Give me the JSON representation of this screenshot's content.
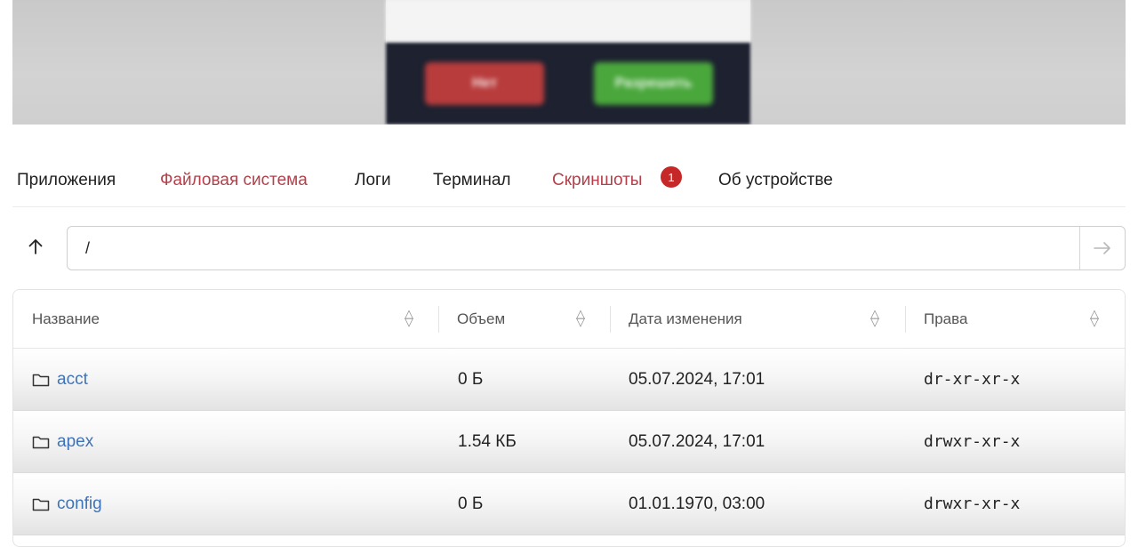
{
  "preview": {
    "left_button": "Нет",
    "right_button": "Разрешить"
  },
  "tabs": [
    {
      "label": "Приложения"
    },
    {
      "label": "Файловая система"
    },
    {
      "label": "Логи"
    },
    {
      "label": "Терминал"
    },
    {
      "label": "Скриншоты",
      "badge": "1"
    },
    {
      "label": "Об устройстве"
    }
  ],
  "active_tab": "Файловая система",
  "colors": {
    "accent": "#b3404a",
    "link": "#3f73b8",
    "badge": "#c62828"
  },
  "icons": {
    "up": "arrow-up-icon",
    "go": "arrow-right-icon",
    "sort": "sort-icon",
    "folder": "folder-icon"
  },
  "path": {
    "value": "/"
  },
  "table": {
    "columns": [
      "Название",
      "Объем",
      "Дата изменения",
      "Права"
    ],
    "rows": [
      {
        "name": "acct",
        "size": "0 Б",
        "modified": "05.07.2024, 17:01",
        "perms": "dr-xr-xr-x"
      },
      {
        "name": "apex",
        "size": "1.54 КБ",
        "modified": "05.07.2024, 17:01",
        "perms": "drwxr-xr-x"
      },
      {
        "name": "config",
        "size": "0 Б",
        "modified": "01.01.1970, 03:00",
        "perms": "drwxr-xr-x"
      }
    ]
  }
}
